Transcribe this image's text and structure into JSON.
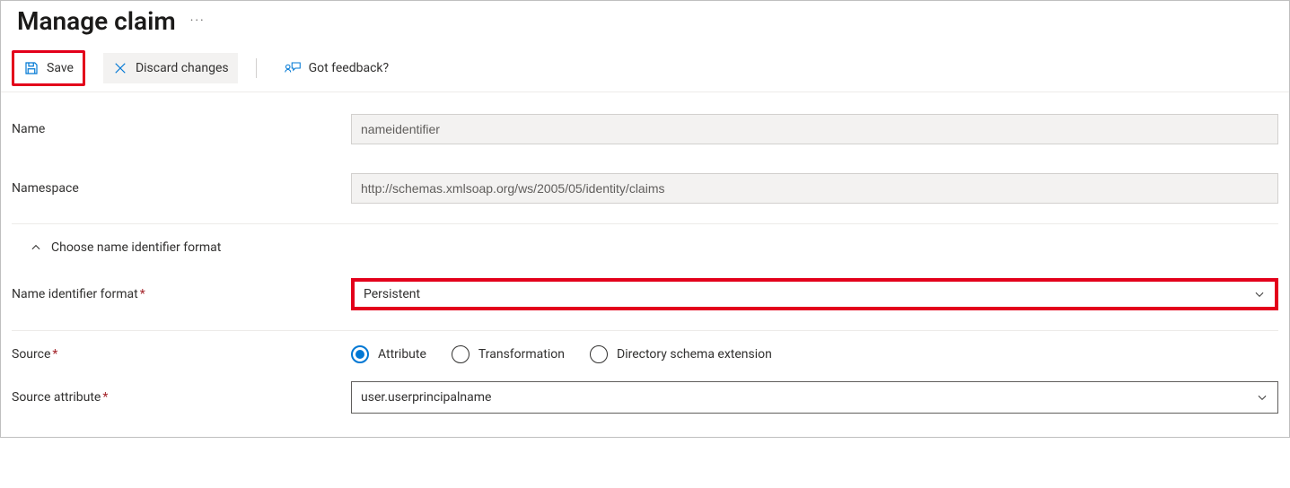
{
  "header": {
    "title": "Manage claim"
  },
  "toolbar": {
    "save_label": "Save",
    "discard_label": "Discard changes",
    "feedback_label": "Got feedback?"
  },
  "form": {
    "name_label": "Name",
    "name_value": "nameidentifier",
    "namespace_label": "Namespace",
    "namespace_value": "http://schemas.xmlsoap.org/ws/2005/05/identity/claims",
    "choose_format_label": "Choose name identifier format",
    "format_label": "Name identifier format",
    "format_value": "Persistent",
    "source_label": "Source",
    "source_options": {
      "attribute": "Attribute",
      "transformation": "Transformation",
      "directory": "Directory schema extension"
    },
    "source_attribute_label": "Source attribute",
    "source_attribute_value": "user.userprincipalname"
  }
}
